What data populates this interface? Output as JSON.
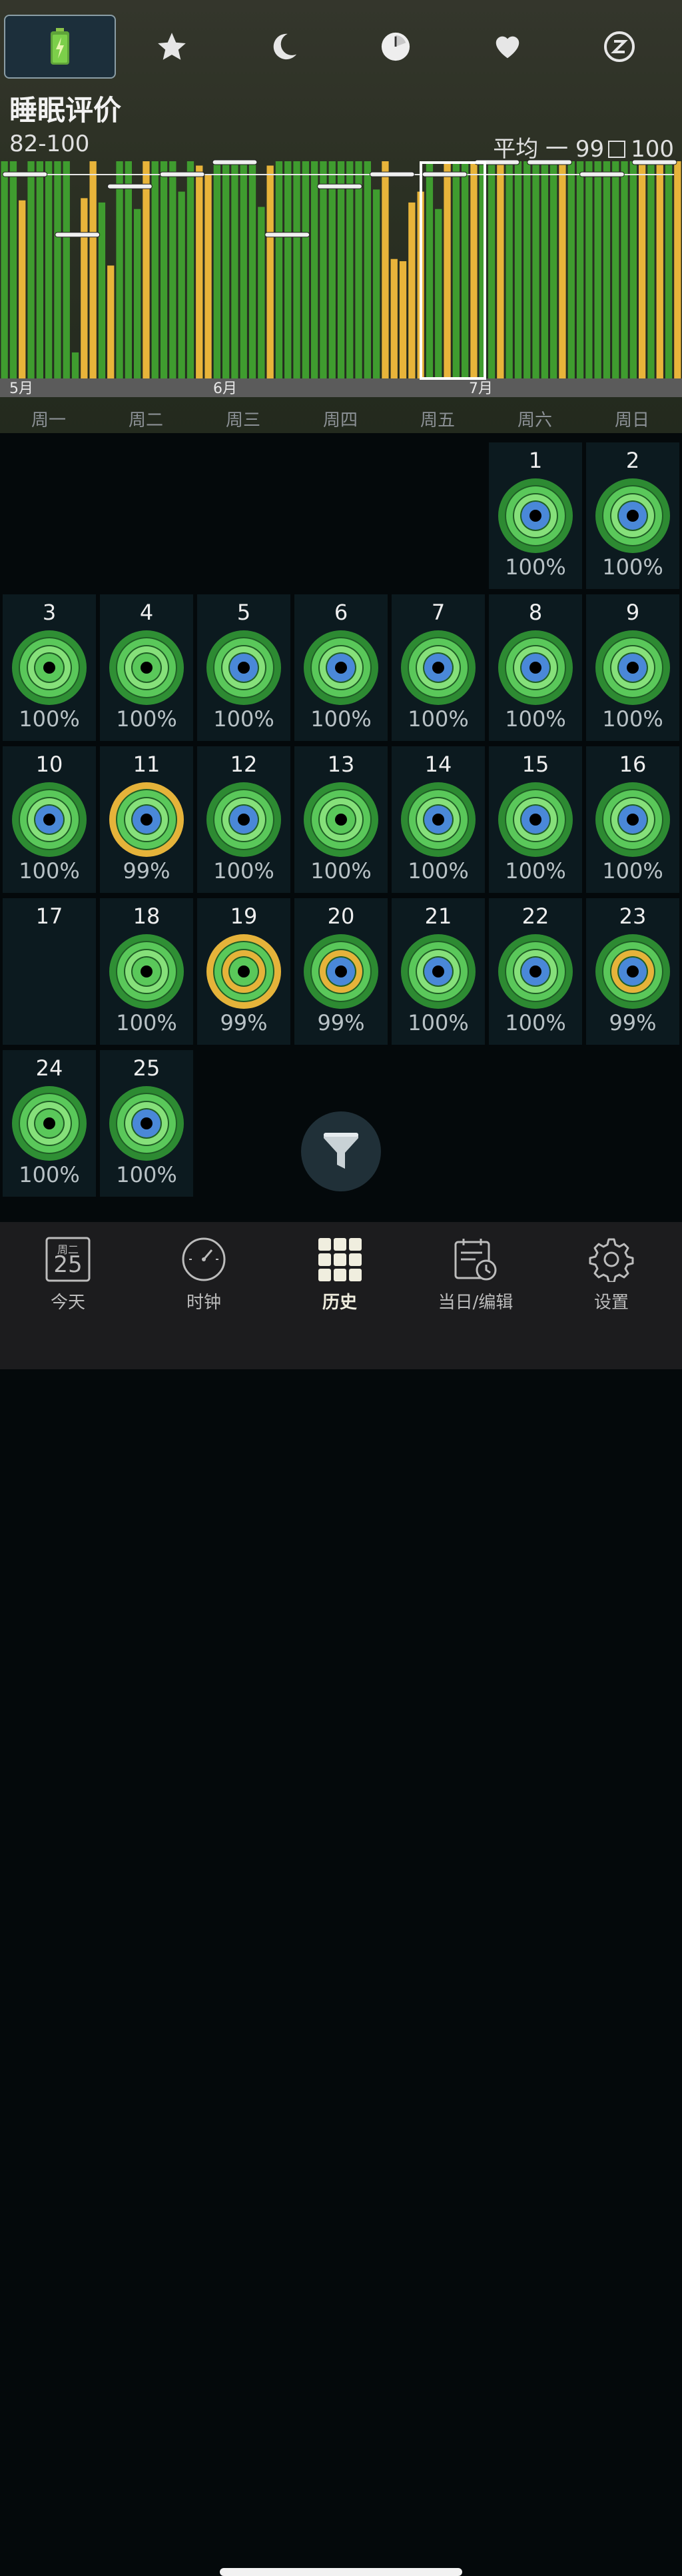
{
  "top_tabs": [
    {
      "icon": "battery-icon",
      "selected": true
    },
    {
      "icon": "star-icon",
      "selected": false
    },
    {
      "icon": "moon-icon",
      "selected": false
    },
    {
      "icon": "clock-icon",
      "selected": false
    },
    {
      "icon": "heart-icon",
      "selected": false
    },
    {
      "icon": "snooze-z-icon",
      "selected": false
    }
  ],
  "header": {
    "title": "睡眠评价",
    "range": "82-100",
    "avg_label": "平均",
    "avg_value": "99",
    "max_value": "100"
  },
  "chart_data": {
    "type": "bar",
    "month_labels": [
      "5月",
      "6月",
      "7月"
    ],
    "green_color": "#3f9c2f",
    "yellow_color": "#e8b43a",
    "week_average_color": "#e6e6e6",
    "bars_percent_height": [
      1.0,
      1.0,
      0.82,
      1.0,
      1.0,
      1.0,
      1.0,
      1.0,
      0.12,
      0.83,
      1.0,
      0.81,
      0.52,
      1.0,
      1.0,
      0.78,
      1.0,
      1.0,
      1.0,
      1.0,
      0.86,
      1.0,
      0.98,
      0.94,
      1.0,
      1.0,
      1.0,
      1.0,
      1.0,
      0.79,
      0.98,
      1.0,
      1.0,
      1.0,
      1.0,
      1.0,
      1.0,
      1.0,
      1.0,
      1.0,
      1.0,
      1.0,
      0.87,
      1.0,
      0.55,
      0.54,
      0.81,
      0.86,
      1.0,
      0.78,
      1.0,
      1.0,
      1.0,
      1.0,
      1.0,
      1.0,
      1.0,
      1.0,
      1.0,
      1.0,
      1.0,
      1.0,
      1.0,
      1.0,
      1.0,
      1.0,
      1.0,
      1.0,
      1.0,
      1.0,
      1.0,
      1.0,
      1.0,
      1.0,
      1.0,
      1.0,
      1.0
    ],
    "yellow_bars": [
      2,
      9,
      10,
      12,
      16,
      22,
      23,
      30,
      43,
      44,
      45,
      46,
      47,
      50,
      53,
      56,
      63,
      72,
      74,
      76
    ],
    "week_averages": [
      99,
      94,
      98,
      99,
      100,
      94,
      98,
      99,
      99,
      100,
      100,
      99,
      100
    ]
  },
  "weekdays": [
    "周一",
    "周二",
    "周三",
    "周四",
    "周五",
    "周六",
    "周日"
  ],
  "calendar": {
    "first_weekday_index": 5,
    "days": [
      {
        "day": "1",
        "percent": "100%",
        "style": "blue"
      },
      {
        "day": "2",
        "percent": "100%",
        "style": "blue"
      },
      {
        "day": "3",
        "percent": "100%",
        "style": "dark"
      },
      {
        "day": "4",
        "percent": "100%",
        "style": "dark"
      },
      {
        "day": "5",
        "percent": "100%",
        "style": "blue"
      },
      {
        "day": "6",
        "percent": "100%",
        "style": "blue"
      },
      {
        "day": "7",
        "percent": "100%",
        "style": "blue"
      },
      {
        "day": "8",
        "percent": "100%",
        "style": "blue"
      },
      {
        "day": "9",
        "percent": "100%",
        "style": "blue"
      },
      {
        "day": "10",
        "percent": "100%",
        "style": "blue"
      },
      {
        "day": "11",
        "percent": "99%",
        "style": "yellow-outer"
      },
      {
        "day": "12",
        "percent": "100%",
        "style": "blue"
      },
      {
        "day": "13",
        "percent": "100%",
        "style": "dark"
      },
      {
        "day": "14",
        "percent": "100%",
        "style": "blue"
      },
      {
        "day": "15",
        "percent": "100%",
        "style": "blue"
      },
      {
        "day": "16",
        "percent": "100%",
        "style": "blue"
      },
      {
        "day": "17",
        "percent": "",
        "style": "none"
      },
      {
        "day": "18",
        "percent": "100%",
        "style": "dark"
      },
      {
        "day": "19",
        "percent": "99%",
        "style": "yellow-both"
      },
      {
        "day": "20",
        "percent": "99%",
        "style": "yellow-inner"
      },
      {
        "day": "21",
        "percent": "100%",
        "style": "blue"
      },
      {
        "day": "22",
        "percent": "100%",
        "style": "blue"
      },
      {
        "day": "23",
        "percent": "99%",
        "style": "yellow-inner"
      },
      {
        "day": "24",
        "percent": "100%",
        "style": "dark"
      },
      {
        "day": "25",
        "percent": "100%",
        "style": "blue"
      }
    ]
  },
  "filter_button": {
    "icon": "funnel-icon"
  },
  "tab_bar": [
    {
      "label": "今天",
      "icon": "calendar-day-icon",
      "date_weekday": "周二",
      "date_num": "25",
      "active": false
    },
    {
      "label": "时钟",
      "icon": "clock-dial-icon",
      "active": false
    },
    {
      "label": "历史",
      "icon": "grid-icon",
      "active": true
    },
    {
      "label": "当日/编辑",
      "icon": "calendar-edit-icon",
      "active": false
    },
    {
      "label": "设置",
      "icon": "gear-icon",
      "active": false
    }
  ]
}
